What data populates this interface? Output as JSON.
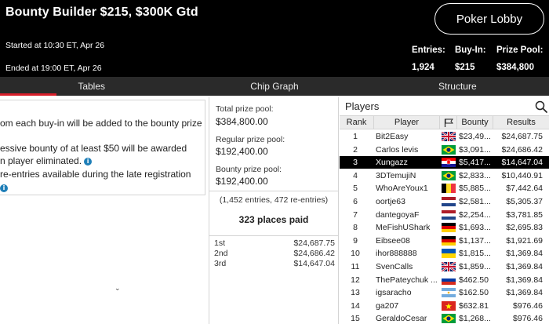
{
  "header": {
    "title": "Bounty Builder $215, $300K Gtd",
    "started": "Started at 10:30 ET, Apr 26",
    "ended": "Ended at 19:00 ET, Apr 26",
    "lobby_button": "Poker Lobby",
    "stats": {
      "entries_label": "Entries:",
      "entries_value": "1,924",
      "buyin_label": "Buy-In:",
      "buyin_value": "$215",
      "prizepool_label": "Prize Pool:",
      "prizepool_value": "$384,800"
    }
  },
  "tabs": [
    {
      "label": "Tables",
      "active": true
    },
    {
      "label": "Chip Graph",
      "active": false
    },
    {
      "label": "Structure",
      "active": false
    }
  ],
  "info": {
    "line1": "om each buy-in will be added to the bounty prize",
    "line2": "essive bounty of at least $50 will be awarded",
    "line3": "n player eliminated.",
    "line4": "re-entries available during the late registration",
    "info_glyph": "i"
  },
  "prize": {
    "total_label": "Total prize pool:",
    "total_value": "$384,800.00",
    "regular_label": "Regular prize pool:",
    "regular_value": "$192,400.00",
    "bounty_label": "Bounty prize pool:",
    "bounty_value": "$192,400.00",
    "entries_note": "(1,452 entries, 472 re-entries)",
    "places_paid": "323 places paid",
    "payouts": [
      {
        "place": "1st",
        "amount": "$24,687.75"
      },
      {
        "place": "2nd",
        "amount": "$24,686.42"
      },
      {
        "place": "3rd",
        "amount": "$14,647.04"
      }
    ],
    "expand_icon": "chevron-down-icon"
  },
  "players": {
    "title": "Players",
    "search_icon": "search-icon",
    "columns": {
      "rank": "Rank",
      "player": "Player",
      "flag": "flag-icon",
      "bounty": "Bounty",
      "results": "Results"
    },
    "rows": [
      {
        "rank": "1",
        "name": "Bit2Easy",
        "flag": "uk",
        "bounty": "$23,49...",
        "result": "$24,687.75",
        "selected": false
      },
      {
        "rank": "2",
        "name": "Carlos levis",
        "flag": "brazil",
        "bounty": "$3,091...",
        "result": "$24,686.42",
        "selected": false
      },
      {
        "rank": "3",
        "name": "Xungazz",
        "flag": "croatia",
        "bounty": "$5,417...",
        "result": "$14,647.04",
        "selected": true
      },
      {
        "rank": "4",
        "name": "3DTemujiN",
        "flag": "brazil",
        "bounty": "$2,833...",
        "result": "$10,440.91",
        "selected": false
      },
      {
        "rank": "5",
        "name": "WhoAreYoux1",
        "flag": "belgium",
        "bounty": "$5,885...",
        "result": "$7,442.64",
        "selected": false
      },
      {
        "rank": "6",
        "name": "oortje63",
        "flag": "netherlands",
        "bounty": "$2,581...",
        "result": "$5,305.37",
        "selected": false
      },
      {
        "rank": "7",
        "name": "dantegoyaF",
        "flag": "netherlands",
        "bounty": "$2,254...",
        "result": "$3,781.85",
        "selected": false
      },
      {
        "rank": "8",
        "name": "MeFishUShark",
        "flag": "germany",
        "bounty": "$1,693...",
        "result": "$2,695.83",
        "selected": false
      },
      {
        "rank": "9",
        "name": "Eibsee08",
        "flag": "germany",
        "bounty": "$1,137...",
        "result": "$1,921.69",
        "selected": false
      },
      {
        "rank": "10",
        "name": "ihor888888",
        "flag": "ukraine",
        "bounty": "$1,815...",
        "result": "$1,369.84",
        "selected": false
      },
      {
        "rank": "11",
        "name": "SvenCalls",
        "flag": "uk",
        "bounty": "$1,859...",
        "result": "$1,369.84",
        "selected": false
      },
      {
        "rank": "12",
        "name": "ThePateychuk ...",
        "flag": "russia",
        "bounty": "$462.50",
        "result": "$1,369.84",
        "selected": false
      },
      {
        "rank": "13",
        "name": "igsaracho",
        "flag": "argentina",
        "bounty": "$162.50",
        "result": "$1,369.84",
        "selected": false
      },
      {
        "rank": "14",
        "name": "ga207",
        "flag": "vietnam",
        "bounty": "$632.81",
        "result": "$976.46",
        "selected": false
      },
      {
        "rank": "15",
        "name": "GeraldoCesar",
        "flag": "brazil",
        "bounty": "$1,268...",
        "result": "$976.46",
        "selected": false
      }
    ]
  },
  "colors": {
    "accent": "#d81e2a",
    "info": "#1f7fb8",
    "header_bg": "#000000",
    "tabbar_bg": "#2a2a2a"
  }
}
